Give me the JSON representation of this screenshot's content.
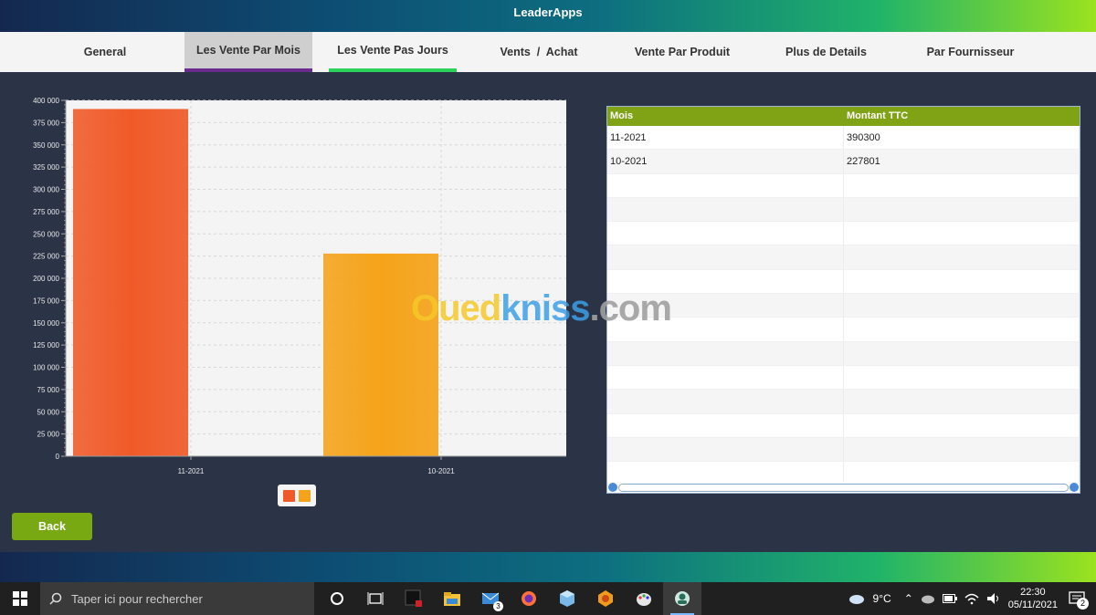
{
  "app": {
    "title": "LeaderApps"
  },
  "tabs": [
    {
      "label": "General"
    },
    {
      "label": "Les Vente Par Mois"
    },
    {
      "label": "Les Vente Pas Jours"
    },
    {
      "label": "Vents  /  Achat"
    },
    {
      "label": "Vente Par Produit"
    },
    {
      "label": "Plus de Details"
    },
    {
      "label": "Par Fournisseur"
    }
  ],
  "chart_data": {
    "type": "bar",
    "categories": [
      "11-2021",
      "10-2021"
    ],
    "values": [
      390300,
      227801
    ],
    "colors": [
      "#f05a28",
      "#f5a31a"
    ],
    "ylim": [
      0,
      400000
    ],
    "yticks": [
      "0",
      "25 000",
      "50 000",
      "75 000",
      "100 000",
      "125 000",
      "150 000",
      "175 000",
      "200 000",
      "225 000",
      "250 000",
      "275 000",
      "300 000",
      "325 000",
      "350 000",
      "375 000",
      "400 000"
    ],
    "grid": true
  },
  "table": {
    "headers": [
      "Mois",
      "Montant TTC"
    ],
    "rows": [
      [
        "11-2021",
        "390300"
      ],
      [
        "10-2021",
        "227801"
      ]
    ],
    "empty_rows": 13
  },
  "back_button": {
    "label": "Back"
  },
  "watermark": {
    "part1": "Oued",
    "part2": "kniss",
    "part3": ".com"
  },
  "taskbar": {
    "search_placeholder": "Taper ici pour rechercher",
    "mail_badge": "3",
    "weather": "9°C",
    "time": "22:30",
    "date": "05/11/2021",
    "notification_count": "2"
  }
}
